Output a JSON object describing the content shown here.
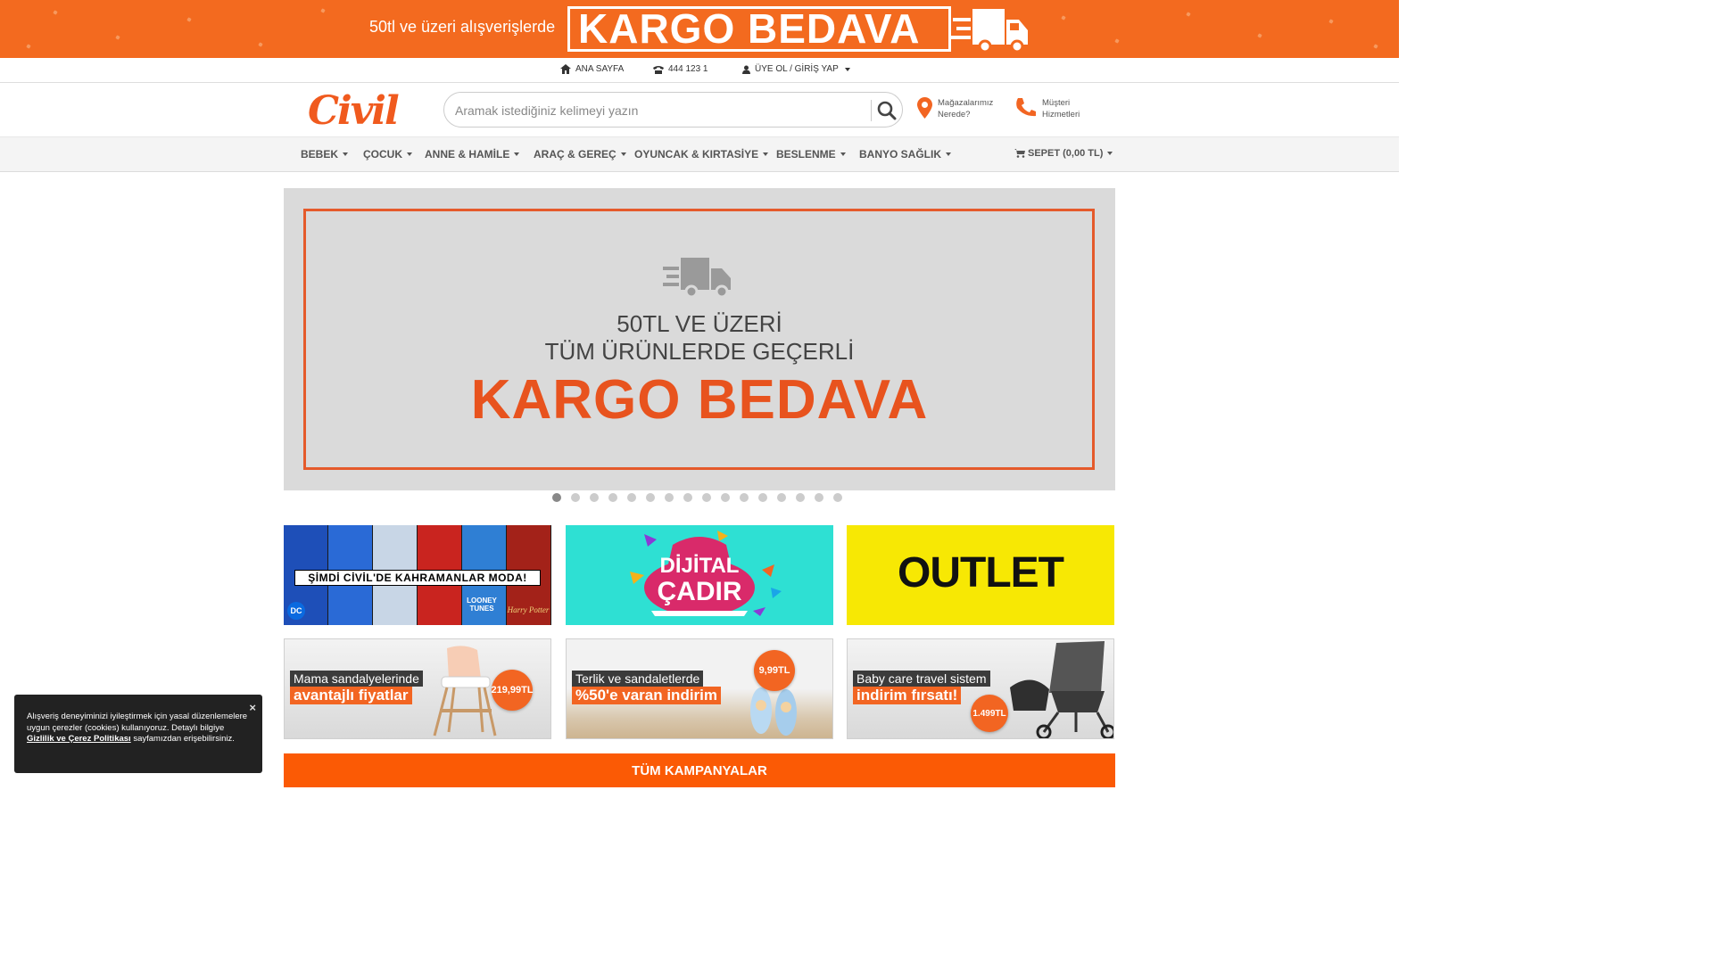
{
  "promo_banner": {
    "small_text": "50tl ve üzeri alışverişlerde",
    "big_text": "KARGO BEDAVA",
    "icon": "delivery-truck-icon"
  },
  "utility_bar": {
    "home": "ANA SAYFA",
    "phone": "444 123 1",
    "account": "ÜYE OL / GİRİŞ YAP"
  },
  "header": {
    "logo_text": "Civil",
    "search_placeholder": "Aramak istediğiniz kelimeyi yazın",
    "stores_line1": "Mağazalarımız",
    "stores_line2": "Nerede?",
    "support_line1": "Müşteri",
    "support_line2": "Hizmetleri"
  },
  "nav": {
    "items": [
      "BEBEK",
      "ÇOCUK",
      "ANNE & HAMİLE",
      "ARAÇ & GEREÇ",
      "OYUNCAK & KIRTASİYE",
      "BESLENME",
      "BANYO SAĞLIK"
    ],
    "cart": "SEPET (0,00 TL)"
  },
  "hero": {
    "line1": "50TL VE ÜZERİ",
    "line2": "TÜM ÜRÜNLERDE GEÇERLİ",
    "line3": "KARGO BEDAVA",
    "slide_count": 16,
    "active_slide": 1
  },
  "tiles": {
    "heroes": "ŞİMDİ CİVİL'DE KAHRAMANLAR MODA!",
    "heroes_brand_left": "DC",
    "heroes_brand_mid": "LOONEY TUNES",
    "heroes_brand_right": "Harry Potter",
    "cadir_line1": "DİJİTAL",
    "cadir_line2": "ÇADIR",
    "outlet": "OUTLET"
  },
  "promos": [
    {
      "line1": "Mama sandalyelerinde",
      "line2": "avantajlı fiyatlar",
      "price": "219,99TL"
    },
    {
      "line1": "Terlik ve sandaletlerde",
      "line2": "%50'e varan indirim",
      "price": "9,99TL"
    },
    {
      "line1": "Baby care travel sistem",
      "line2": "indirim fırsatı!",
      "price": "1.499TL"
    }
  ],
  "all_campaigns": "TÜM KAMPANYALAR",
  "cookie": {
    "text_before": "Alışveriş deneyiminizi iyileştirmek için yasal düzenlemelere uygun çerezler (cookies) kullanıyoruz. Detaylı bilgiye ",
    "link": "Gizlilik ve Çerez Politikası",
    "text_after": " sayfamızdan erişebilirsiniz.",
    "close": "×"
  },
  "colors": {
    "brand_orange": "#f36a1f",
    "hero_orange": "#e8531e",
    "campaign_orange": "#fb5a05",
    "outlet_yellow": "#f7e804",
    "cadir_teal": "#2ee0d3"
  }
}
